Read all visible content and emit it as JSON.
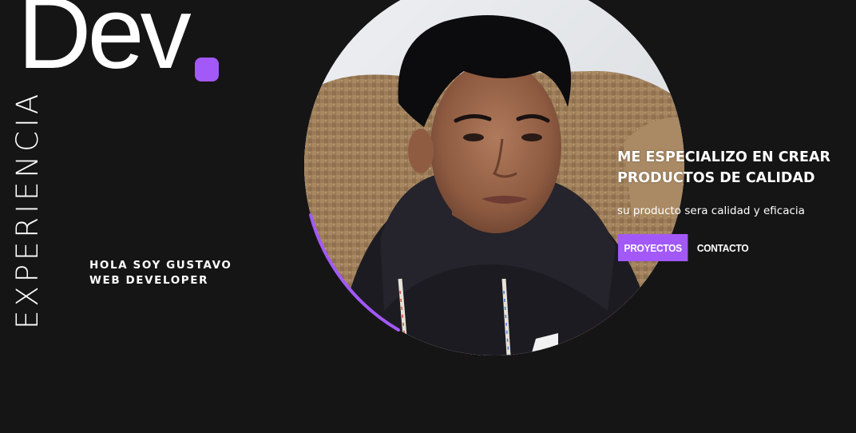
{
  "logo": {
    "text": "Dev",
    "dot_color": "#a259f7"
  },
  "vertical_word": "EXPERIENCIA",
  "intro": {
    "line1": "HOLA SOY GUSTAVO",
    "line2": "WEB DEVELOPER"
  },
  "hero": {
    "headline_line1": "ME ESPECIALIZO EN CREAR",
    "headline_line2": "PRODUCTOS DE CALIDAD",
    "subtext": "su producto sera calidad y eficacia"
  },
  "buttons": {
    "primary_label": "PROYECTOS",
    "secondary_label": "CONTACTO"
  },
  "colors": {
    "background": "#161516",
    "accent": "#a259f7",
    "text": "#ffffff"
  }
}
